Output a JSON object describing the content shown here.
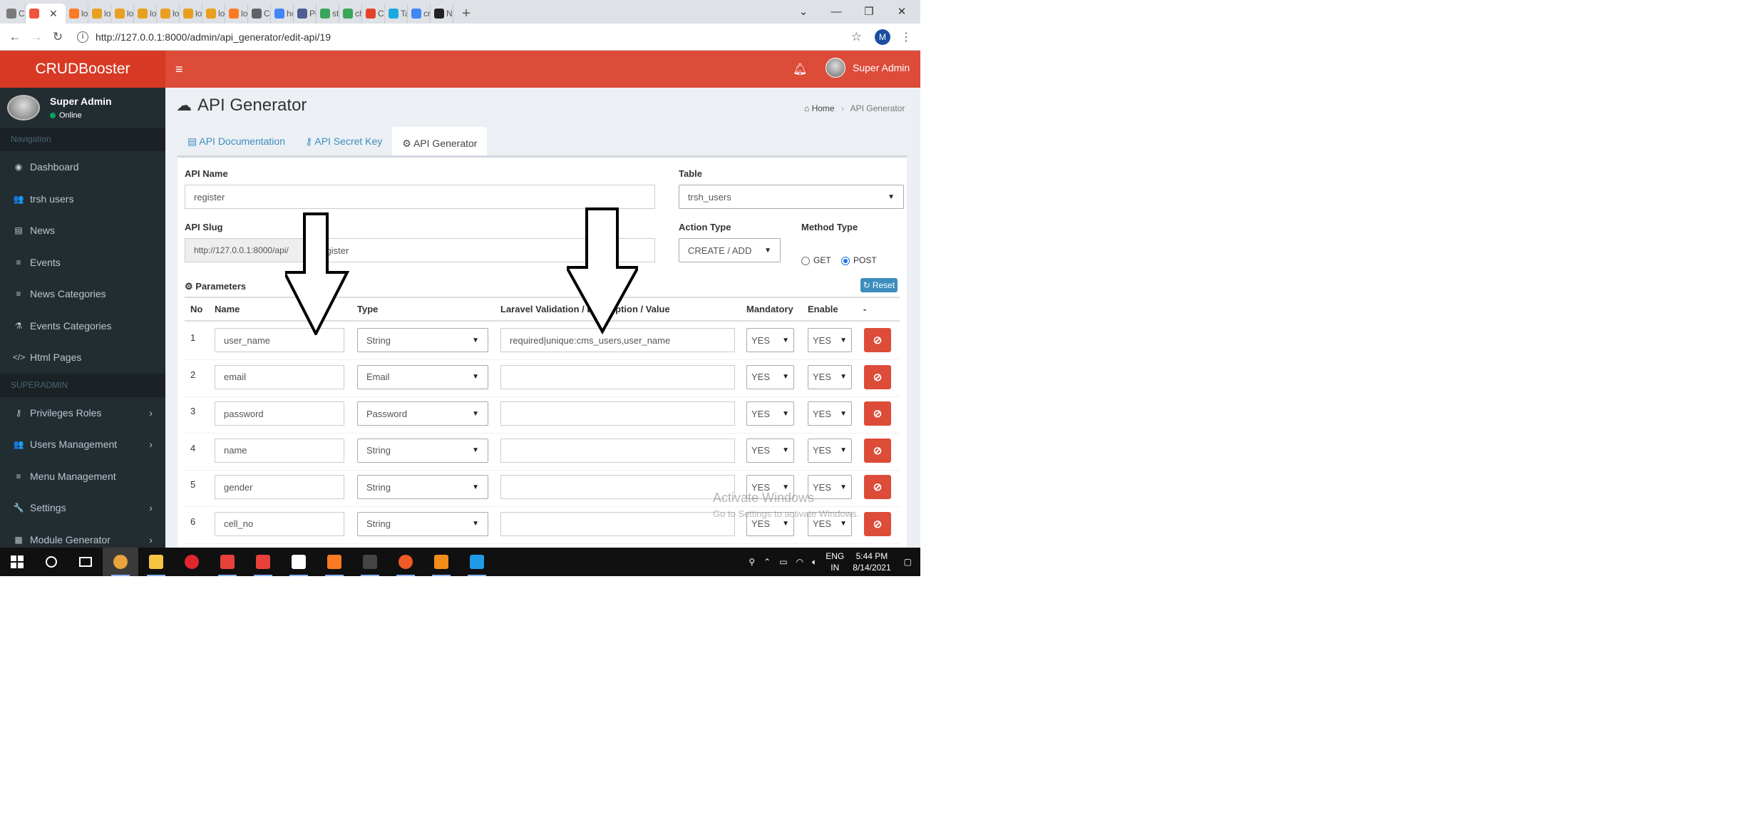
{
  "browser": {
    "tabs": [
      {
        "label": "CF",
        "icon": "chrome-icon",
        "color": "#7a7a7a"
      },
      {
        "label": "",
        "icon": "laravel-icon",
        "color": "#f05340",
        "active": true
      },
      {
        "label": "lo",
        "icon": "xampp-icon",
        "color": "#fb7a24"
      },
      {
        "label": "lo",
        "icon": "chart-icon",
        "color": "#e8a020"
      },
      {
        "label": "lo",
        "icon": "chart-icon",
        "color": "#e8a020"
      },
      {
        "label": "lo",
        "icon": "chart-icon",
        "color": "#e8a020"
      },
      {
        "label": "lo",
        "icon": "chart-icon",
        "color": "#e8a020"
      },
      {
        "label": "lo",
        "icon": "chart-icon",
        "color": "#e8a020"
      },
      {
        "label": "lo",
        "icon": "chart-icon",
        "color": "#e8a020"
      },
      {
        "label": "lo",
        "icon": "xampp-icon",
        "color": "#fb7a24"
      },
      {
        "label": "CF",
        "icon": "globe-icon",
        "color": "#5f6368"
      },
      {
        "label": "hc",
        "icon": "google-icon",
        "color": "#4285f4"
      },
      {
        "label": "Pł",
        "icon": "php-icon",
        "color": "#4f5b93"
      },
      {
        "label": "sti",
        "icon": "git-icon",
        "color": "#3ba55c"
      },
      {
        "label": "ch",
        "icon": "git-icon",
        "color": "#3ba55c"
      },
      {
        "label": "Cr",
        "icon": "gitlab-icon",
        "color": "#e24329"
      },
      {
        "label": "Ta",
        "icon": "tabnine-icon",
        "color": "#1ba9e0"
      },
      {
        "label": "cr",
        "icon": "google-icon",
        "color": "#4285f4"
      },
      {
        "label": "Ne",
        "icon": "github-icon",
        "color": "#222222"
      }
    ],
    "new_tab": "+",
    "url": "http://127.0.0.1:8000/admin/api_generator/edit-api/19",
    "profile_initial": "M"
  },
  "app": {
    "brand": "CRUDBooster",
    "header_user": "Super Admin",
    "accent": "#dd4b39"
  },
  "sidebar": {
    "user_name": "Super Admin",
    "status": "Online",
    "nav_header": "Navigation",
    "items": [
      {
        "label": "Dashboard",
        "icon": "dashboard-icon",
        "glyph": "◉"
      },
      {
        "label": "trsh users",
        "icon": "users-icon",
        "glyph": "👥"
      },
      {
        "label": "News",
        "icon": "newspaper-icon",
        "glyph": "▤"
      },
      {
        "label": "Events",
        "icon": "list-icon",
        "glyph": "≡"
      },
      {
        "label": "News Categories",
        "icon": "list-icon",
        "glyph": "≡"
      },
      {
        "label": "Events Categories",
        "icon": "flask-icon",
        "glyph": "⚗"
      },
      {
        "label": "Html Pages",
        "icon": "code-icon",
        "glyph": "</>"
      }
    ],
    "admin_header": "SUPERADMIN",
    "admin_items": [
      {
        "label": "Privileges Roles",
        "icon": "key-icon",
        "glyph": "⚷",
        "has_sub": true
      },
      {
        "label": "Users Management",
        "icon": "users-icon",
        "glyph": "👥",
        "has_sub": true
      },
      {
        "label": "Menu Management",
        "icon": "bars-icon",
        "glyph": "≡",
        "has_sub": false
      },
      {
        "label": "Settings",
        "icon": "wrench-icon",
        "glyph": "🔧",
        "has_sub": true
      },
      {
        "label": "Module Generator",
        "icon": "grid-icon",
        "glyph": "▦",
        "has_sub": true
      }
    ]
  },
  "page": {
    "title": "API Generator",
    "breadcrumb_home": "Home",
    "breadcrumb_current": "API Generator",
    "tabs": [
      "API Documentation",
      "API Secret Key",
      "API Generator"
    ]
  },
  "form": {
    "api_name_label": "API Name",
    "api_name_value": "register",
    "table_label": "Table",
    "table_value": "trsh_users",
    "api_slug_label": "API Slug",
    "api_slug_prefix": "http://127.0.0.1:8000/api/",
    "api_slug_value": "register",
    "action_type_label": "Action Type",
    "action_type_value": "CREATE / ADD",
    "method_type_label": "Method Type",
    "method_get": "GET",
    "method_post": "POST",
    "method_selected": "POST",
    "parameters_label": "Parameters",
    "reset_label": "Reset"
  },
  "params": {
    "headers": [
      "No",
      "Name",
      "Type",
      "Laravel Validation / Description / Value",
      "Mandatory",
      "Enable",
      "-"
    ],
    "rows": [
      {
        "no": "1",
        "name": "user_name",
        "type": "String",
        "validation": "required|unique:cms_users,user_name",
        "mandatory": "YES",
        "enable": "YES"
      },
      {
        "no": "2",
        "name": "email",
        "type": "Email",
        "validation": "",
        "mandatory": "YES",
        "enable": "YES"
      },
      {
        "no": "3",
        "name": "password",
        "type": "Password",
        "validation": "",
        "mandatory": "YES",
        "enable": "YES"
      },
      {
        "no": "4",
        "name": "name",
        "type": "String",
        "validation": "",
        "mandatory": "YES",
        "enable": "YES"
      },
      {
        "no": "5",
        "name": "gender",
        "type": "String",
        "validation": "",
        "mandatory": "YES",
        "enable": "YES"
      },
      {
        "no": "6",
        "name": "cell_no",
        "type": "String",
        "validation": "",
        "mandatory": "YES",
        "enable": "YES"
      }
    ]
  },
  "watermark": {
    "line1": "Activate Windows",
    "line2": "Go to Settings to activate Windows."
  },
  "taskbar": {
    "apps": [
      {
        "icon": "chrome-icon",
        "color": "#e8a33a",
        "open": true,
        "active": true
      },
      {
        "icon": "file-explorer-icon",
        "color": "#f5c542",
        "open": true
      },
      {
        "icon": "opera-icon",
        "color": "#e0262d",
        "open": false
      },
      {
        "icon": "anydesk-icon",
        "color": "#e8413c",
        "open": true
      },
      {
        "icon": "vivaldi-icon",
        "color": "#e8413c",
        "open": true
      },
      {
        "icon": "sticky-notes-icon",
        "color": "#ffffff",
        "open": true
      },
      {
        "icon": "xampp-icon",
        "color": "#fb7a24",
        "open": true
      },
      {
        "icon": "terminal-icon",
        "color": "#444444",
        "open": true
      },
      {
        "icon": "postman-icon",
        "color": "#ef5b25",
        "open": true
      },
      {
        "icon": "sublime-icon",
        "color": "#f28d1a",
        "open": true
      },
      {
        "icon": "stats-icon",
        "color": "#1e9be9",
        "open": true
      }
    ],
    "lang_1": "ENG",
    "lang_2": "IN",
    "time": "5:44 PM",
    "date": "8/14/2021"
  }
}
